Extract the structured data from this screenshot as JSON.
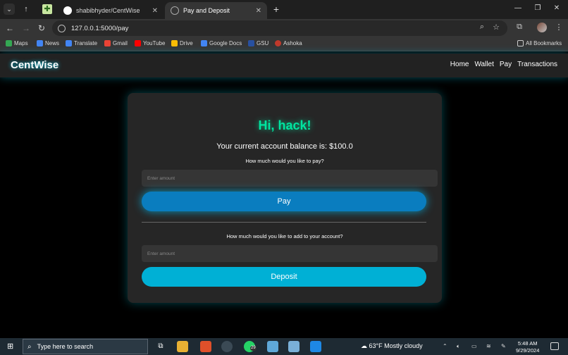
{
  "browser": {
    "tabs": [
      {
        "title": "shabibhyder/CentWise",
        "close": "✕"
      },
      {
        "title": "Pay and Deposit",
        "close": "✕"
      }
    ],
    "new_tab": "+",
    "window_controls": {
      "minimize": "—",
      "restore": "❐",
      "close": "✕"
    },
    "url": "127.0.0.1:5000/pay",
    "bookmarks": [
      {
        "label": "Maps",
        "icon": "maps-icon",
        "color": "#34a853"
      },
      {
        "label": "News",
        "icon": "news-icon",
        "color": "#4285f4"
      },
      {
        "label": "Translate",
        "icon": "translate-icon",
        "color": "#4285f4"
      },
      {
        "label": "Gmail",
        "icon": "gmail-icon",
        "color": "#ea4335"
      },
      {
        "label": "YouTube",
        "icon": "youtube-icon",
        "color": "#ff0000"
      },
      {
        "label": "Drive",
        "icon": "drive-icon",
        "color": "#fbbc04"
      },
      {
        "label": "Google Docs",
        "icon": "docs-icon",
        "color": "#4285f4"
      },
      {
        "label": "GSU",
        "icon": "gsu-icon",
        "color": "#2850a0"
      },
      {
        "label": "Ashoka",
        "icon": "ashoka-icon",
        "color": "#c0392b"
      }
    ],
    "all_bookmarks": "All Bookmarks"
  },
  "navbar": {
    "brand": "CentWise",
    "links": [
      "Home",
      "Wallet",
      "Pay",
      "Transactions"
    ]
  },
  "card": {
    "greeting": "Hi, hack!",
    "balance_text": "Your current account balance is: $100.0",
    "pay": {
      "question": "How much would you like to pay?",
      "placeholder": "Enter amount",
      "button": "Pay"
    },
    "deposit": {
      "question": "How much would you like to add to your account?",
      "placeholder": "Enter amount",
      "button": "Deposit"
    }
  },
  "taskbar": {
    "search_placeholder": "Type here to search",
    "weather": "63°F  Mostly cloudy",
    "time": "5:48 AM",
    "date": "9/29/2024",
    "whatsapp_badge": "29"
  },
  "colors": {
    "accent_green": "#00e5a0",
    "pay_button": "#0a7dbf",
    "deposit_button": "#00b0d5"
  }
}
